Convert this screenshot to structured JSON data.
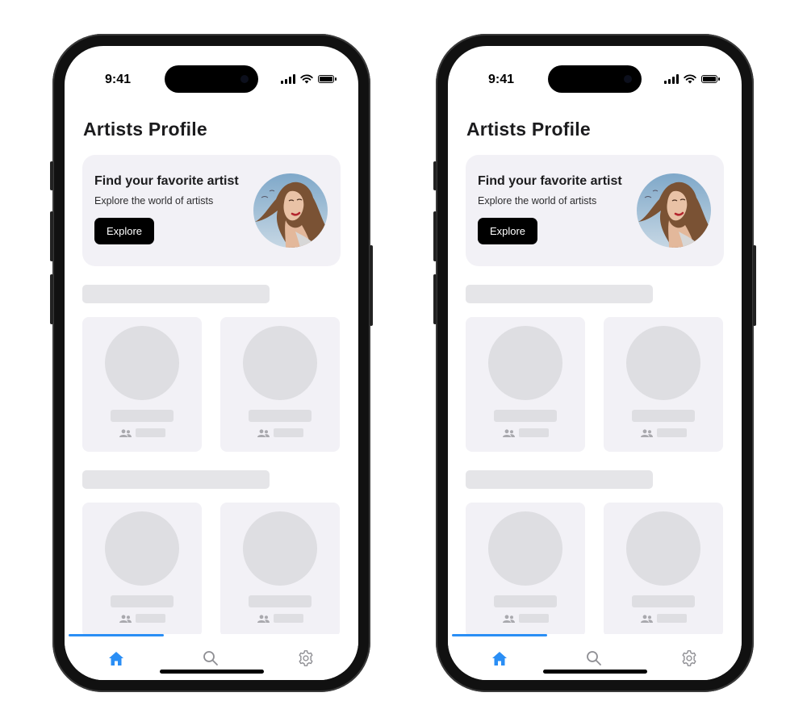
{
  "screens": [
    {
      "status_bar": {
        "time": "9:41"
      },
      "page_title": "Artists Profile",
      "hero": {
        "title": "Find your favorite artist",
        "subtitle": "Explore the world of artists",
        "button_label": "Explore"
      },
      "tabs": [
        {
          "name": "home",
          "icon": "home-icon",
          "active": true
        },
        {
          "name": "search",
          "icon": "search-icon",
          "active": false
        },
        {
          "name": "settings",
          "icon": "gear-icon",
          "active": false
        }
      ]
    },
    {
      "status_bar": {
        "time": "9:41"
      },
      "page_title": "Artists Profile",
      "hero": {
        "title": "Find your favorite artist",
        "subtitle": "Explore the world of artists",
        "button_label": "Explore"
      },
      "tabs": [
        {
          "name": "home",
          "icon": "home-icon",
          "active": true
        },
        {
          "name": "search",
          "icon": "search-icon",
          "active": false
        },
        {
          "name": "settings",
          "icon": "gear-icon",
          "active": false
        }
      ]
    }
  ],
  "colors": {
    "accent": "#2a8ef5",
    "hero_background": "#f2f1f6",
    "skeleton": "#dedee2",
    "button": "#000000"
  }
}
